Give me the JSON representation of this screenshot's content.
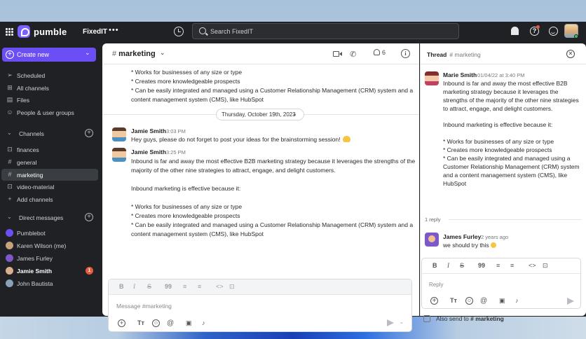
{
  "topbar": {
    "app_name": "pumble",
    "workspace": "FixedIT",
    "more": "•••",
    "search_placeholder": "Search FixedIT"
  },
  "sidebar": {
    "create_label": "Create new",
    "nav": [
      {
        "label": "Scheduled",
        "icon": "send-icon"
      },
      {
        "label": "All channels",
        "icon": "channels-icon"
      },
      {
        "label": "Files",
        "icon": "file-icon"
      },
      {
        "label": "People & user groups",
        "icon": "people-icon"
      }
    ],
    "channels_label": "Channels",
    "channels": [
      {
        "label": "finances",
        "icon": "lock-icon"
      },
      {
        "label": "general",
        "icon": "hash-icon"
      },
      {
        "label": "marketing",
        "icon": "hash-icon",
        "active": true
      },
      {
        "label": "video-material",
        "icon": "lock-icon"
      }
    ],
    "add_channels": "Add channels",
    "dm_label": "Direct messages",
    "dms": [
      {
        "label": "Pumblebot",
        "color": "#6c4ef5"
      },
      {
        "label": "Karen Wilson (me)",
        "color": "#c7a27a"
      },
      {
        "label": "James Furley",
        "color": "#7d58c8"
      },
      {
        "label": "Jamie Smith",
        "color": "#d9b08c",
        "bold": true,
        "badge": "1"
      },
      {
        "label": "John Bautista",
        "color": "#8aa2b8"
      }
    ]
  },
  "channel": {
    "hash": "#",
    "name": "marketing",
    "members_count": "6",
    "top_lines": [
      "* Works for businesses of any size or type",
      "* Creates more knowledgeable prospects",
      "* Can be easily integrated and managed using a Customer Relationship Management (CRM) system and a",
      "content management system (CMS), like HubSpot"
    ],
    "date_label": "Thursday, October 19th, 2023",
    "messages": [
      {
        "sender": "Jamie Smith",
        "time": "3:03 PM",
        "lines": [
          "Hey guys, please do not forget to post your ideas for the brainstorming session!"
        ]
      },
      {
        "sender": "Jamie Smith",
        "time": "3:25 PM",
        "lines": [
          "Inbound is far and away the most effective B2B marketing strategy because it leverages the strengths of the",
          "majority of the other nine strategies to attract, engage, and delight customers.",
          "",
          "Inbound marketing is effective because it:",
          "",
          "* Works for businesses of any size or type",
          "* Creates more knowledgeable prospects",
          "* Can be easily integrated and managed using a Customer Relationship Management (CRM) system and a",
          "content management system (CMS), like HubSpot"
        ]
      }
    ],
    "composer_placeholder": "Message #marketing"
  },
  "format_bar": {
    "bold": "B",
    "italic": "I",
    "strike": "S",
    "quote": "99",
    "ol": "≡",
    "ul": "≡",
    "code": "<>",
    "codeblock": "⊡"
  },
  "thread": {
    "title": "Thread",
    "channel": "# marketing",
    "root": {
      "sender": "Marie Smith",
      "time": "01/04/22 at 3:40 PM",
      "lines": [
        "Inbound is far and away the most effective B2B",
        "marketing strategy because it leverages the",
        "strengths of the majority of the other nine strategies",
        "to attract, engage, and delight customers.",
        "",
        "Inbound marketing is effective because it:",
        "",
        "* Works for businesses of any size or type",
        "* Creates more knowledgeable prospects",
        "* Can be easily integrated and managed using a",
        "Customer Relationship Management (CRM) system",
        "and a content management system (CMS), like",
        "HubSpot"
      ]
    },
    "reply_count": "1 reply",
    "reply": {
      "sender": "James Furley",
      "time": "2 years ago",
      "text": "we should try this"
    },
    "reply_placeholder": "Reply",
    "also_send_prefix": "Also send to",
    "also_send_channel": "# marketing"
  }
}
